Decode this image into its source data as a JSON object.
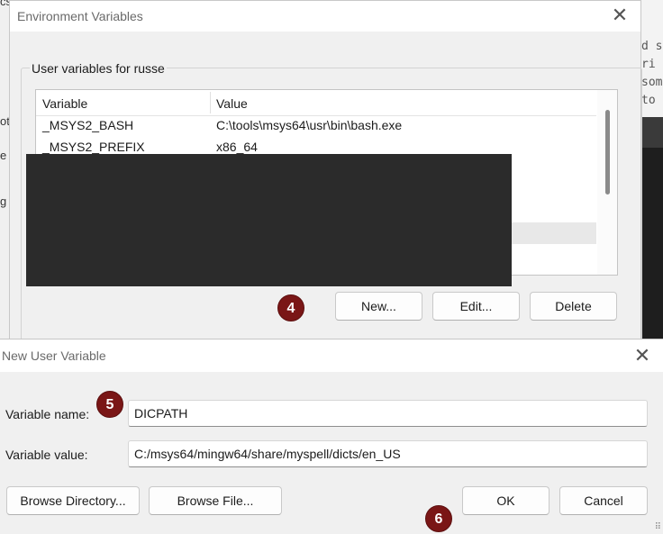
{
  "background_left": {
    "fragments": [
      "cs",
      "ot",
      "e",
      "g"
    ]
  },
  "background_terminal": {
    "lines": [
      "d s",
      "ri",
      "som",
      " to"
    ]
  },
  "env_window": {
    "title": "Environment Variables",
    "close_glyph": "✕",
    "group_label": "User variables for russe",
    "columns": [
      "Variable",
      "Value"
    ],
    "rows": [
      {
        "variable": "_MSYS2_BASH",
        "value": "C:\\tools\\msys64\\usr\\bin\\bash.exe"
      },
      {
        "variable": "_MSYS2_PREFIX",
        "value": "x86_64"
      }
    ],
    "buttons": {
      "new": "New...",
      "edit": "Edit...",
      "delete": "Delete"
    },
    "redaction_color": "#2b2b2b"
  },
  "step_markers": {
    "four": "4",
    "five": "5",
    "six": "6",
    "color": "#7a1616"
  },
  "new_var_dialog": {
    "title": "New User Variable",
    "close_glyph": "✕",
    "name_label": "Variable name:",
    "name_value": "DICPATH",
    "value_label": "Variable value:",
    "value_value": "C:/msys64/mingw64/share/myspell/dicts/en_US",
    "buttons": {
      "browse_directory": "Browse Directory...",
      "browse_file": "Browse File...",
      "ok": "OK",
      "cancel": "Cancel"
    },
    "resize_grip_glyph": "⠿"
  }
}
